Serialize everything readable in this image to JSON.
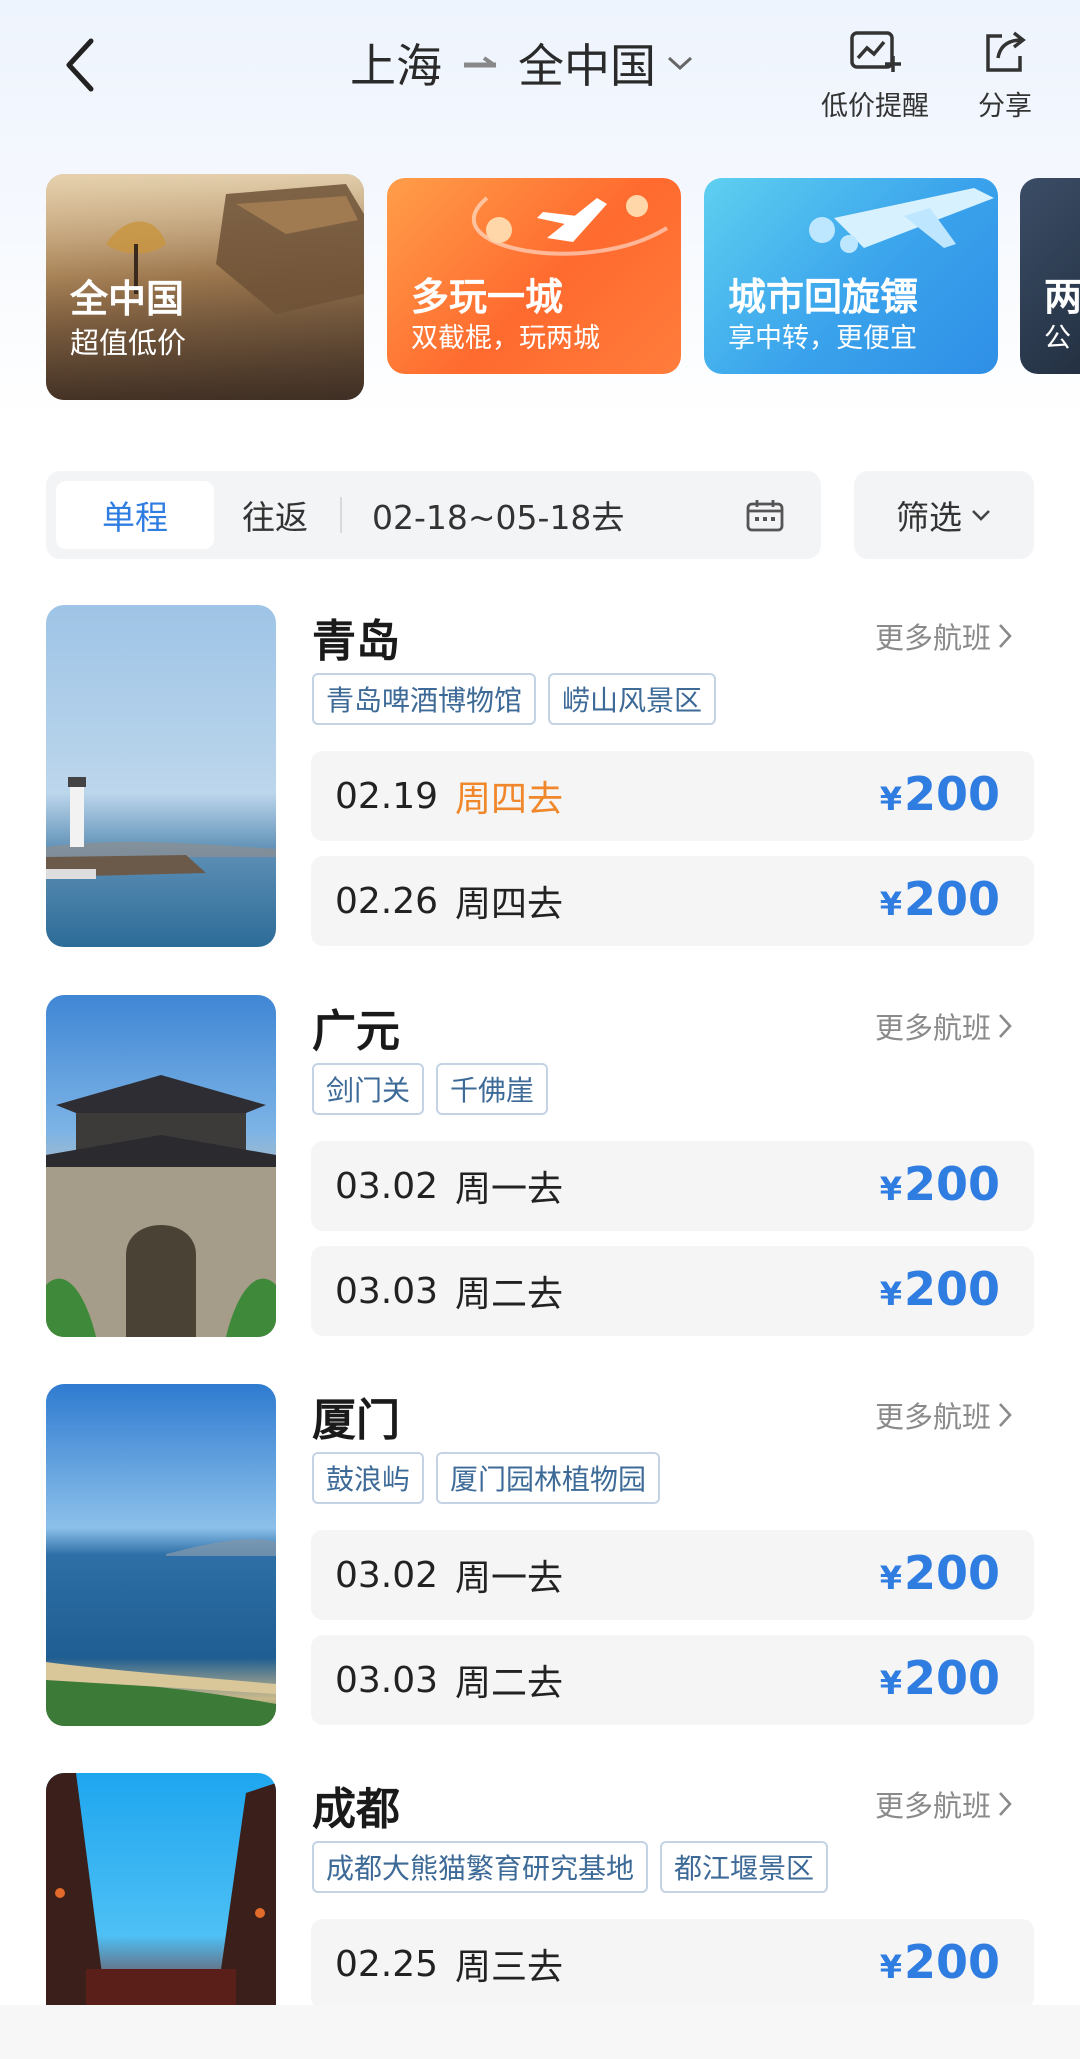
{
  "header": {
    "from_city": "上海",
    "to_city": "全中国",
    "alert_label": "低价提醒",
    "share_label": "分享"
  },
  "banners": [
    {
      "title": "全中国",
      "subtitle": "超值低价"
    },
    {
      "title": "多玩一城",
      "subtitle": "双截棍，玩两城"
    },
    {
      "title": "城市回旋镖",
      "subtitle": "享中转，更便宜"
    },
    {
      "title": "两",
      "subtitle": "公"
    }
  ],
  "filter": {
    "one_way": "单程",
    "round_trip": "往返",
    "date_range": "02-18~05-18去",
    "sift_label": "筛选"
  },
  "destinations": [
    {
      "city": "青岛",
      "more": "更多航班",
      "tags": [
        "青岛啤酒博物馆",
        "崂山风景区"
      ],
      "flights": [
        {
          "date": "02.19",
          "day": "周四去",
          "currency": "¥",
          "price": "200"
        },
        {
          "date": "02.26",
          "day": "周四去",
          "currency": "¥",
          "price": "200"
        }
      ]
    },
    {
      "city": "广元",
      "more": "更多航班",
      "tags": [
        "剑门关",
        "千佛崖"
      ],
      "flights": [
        {
          "date": "03.02",
          "day": "周一去",
          "currency": "¥",
          "price": "200"
        },
        {
          "date": "03.03",
          "day": "周二去",
          "currency": "¥",
          "price": "200"
        }
      ]
    },
    {
      "city": "厦门",
      "more": "更多航班",
      "tags": [
        "鼓浪屿",
        "厦门园林植物园"
      ],
      "flights": [
        {
          "date": "03.02",
          "day": "周一去",
          "currency": "¥",
          "price": "200"
        },
        {
          "date": "03.03",
          "day": "周二去",
          "currency": "¥",
          "price": "200"
        }
      ]
    },
    {
      "city": "成都",
      "more": "更多航班",
      "tags": [
        "成都大熊猫繁育研究基地",
        "都江堰景区"
      ],
      "flights": [
        {
          "date": "02.25",
          "day": "周三去",
          "currency": "¥",
          "price": "200"
        }
      ]
    }
  ],
  "colors": {
    "accent_blue": "#2f7de1",
    "highlight_orange": "#f0872a",
    "tag_text": "#3d6a97"
  }
}
